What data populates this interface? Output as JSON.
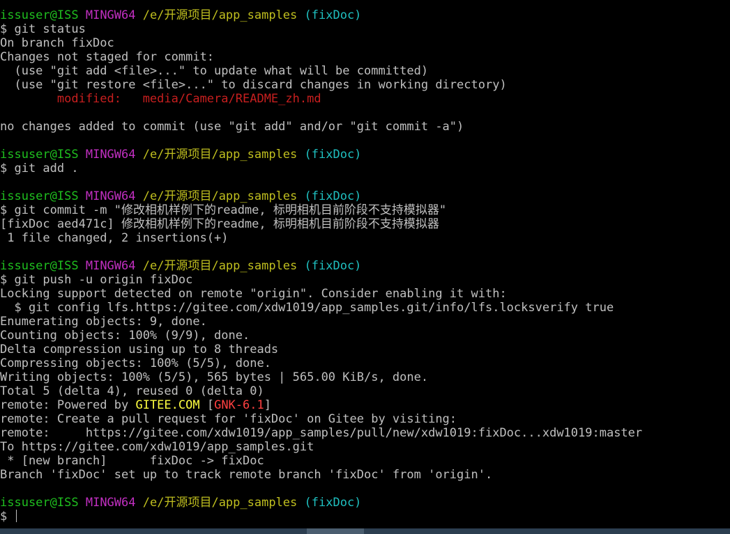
{
  "prompt": {
    "user_host": "issuser@ISS",
    "system": "MINGW64",
    "path": "/e/开源项目/app_samples",
    "branch": "(fixDoc)"
  },
  "lines": [
    {
      "type": "prompt"
    },
    {
      "type": "text",
      "segments": [
        {
          "text": "$ git status",
          "color": "default"
        }
      ]
    },
    {
      "type": "text",
      "segments": [
        {
          "text": "On branch fixDoc",
          "color": "default"
        }
      ]
    },
    {
      "type": "text",
      "segments": [
        {
          "text": "Changes not staged for commit:",
          "color": "default"
        }
      ]
    },
    {
      "type": "text",
      "segments": [
        {
          "text": "  (use \"git add <file>...\" to update what will be committed)",
          "color": "default"
        }
      ]
    },
    {
      "type": "text",
      "segments": [
        {
          "text": "  (use \"git restore <file>...\" to discard changes in working directory)",
          "color": "default"
        }
      ]
    },
    {
      "type": "text",
      "segments": [
        {
          "text": "        modified:   media/Camera/README_zh.md",
          "color": "red"
        }
      ]
    },
    {
      "type": "blank"
    },
    {
      "type": "text",
      "segments": [
        {
          "text": "no changes added to commit (use \"git add\" and/or \"git commit -a\")",
          "color": "default"
        }
      ]
    },
    {
      "type": "blank"
    },
    {
      "type": "prompt"
    },
    {
      "type": "text",
      "segments": [
        {
          "text": "$ git add .",
          "color": "default"
        }
      ]
    },
    {
      "type": "blank"
    },
    {
      "type": "prompt"
    },
    {
      "type": "text",
      "segments": [
        {
          "text": "$ git commit -m \"修改相机样例下的readme, 标明相机目前阶段不支持模拟器\"",
          "color": "default"
        }
      ]
    },
    {
      "type": "text",
      "segments": [
        {
          "text": "[fixDoc aed471c] 修改相机样例下的readme, 标明相机目前阶段不支持模拟器",
          "color": "default"
        }
      ]
    },
    {
      "type": "text",
      "segments": [
        {
          "text": " 1 file changed, 2 insertions(+)",
          "color": "default"
        }
      ]
    },
    {
      "type": "blank"
    },
    {
      "type": "prompt"
    },
    {
      "type": "text",
      "segments": [
        {
          "text": "$ git push -u origin fixDoc",
          "color": "default"
        }
      ]
    },
    {
      "type": "text",
      "segments": [
        {
          "text": "Locking support detected on remote \"origin\". Consider enabling it with:",
          "color": "default"
        }
      ]
    },
    {
      "type": "text",
      "segments": [
        {
          "text": "  $ git config lfs.https://gitee.com/xdw1019/app_samples.git/info/lfs.locksverify true",
          "color": "default"
        }
      ]
    },
    {
      "type": "text",
      "segments": [
        {
          "text": "Enumerating objects: 9, done.",
          "color": "default"
        }
      ]
    },
    {
      "type": "text",
      "segments": [
        {
          "text": "Counting objects: 100% (9/9), done.",
          "color": "default"
        }
      ]
    },
    {
      "type": "text",
      "segments": [
        {
          "text": "Delta compression using up to 8 threads",
          "color": "default"
        }
      ]
    },
    {
      "type": "text",
      "segments": [
        {
          "text": "Compressing objects: 100% (5/5), done.",
          "color": "default"
        }
      ]
    },
    {
      "type": "text",
      "segments": [
        {
          "text": "Writing objects: 100% (5/5), 565 bytes | 565.00 KiB/s, done.",
          "color": "default"
        }
      ]
    },
    {
      "type": "text",
      "segments": [
        {
          "text": "Total 5 (delta 4), reused 0 (delta 0)",
          "color": "default"
        }
      ]
    },
    {
      "type": "text",
      "segments": [
        {
          "text": "remote: Powered by ",
          "color": "default"
        },
        {
          "text": "GITEE.COM",
          "color": "byellow"
        },
        {
          "text": " [",
          "color": "default"
        },
        {
          "text": "GNK-6.1",
          "color": "bred"
        },
        {
          "text": "]",
          "color": "default"
        }
      ]
    },
    {
      "type": "text",
      "segments": [
        {
          "text": "remote: Create a pull request for 'fixDoc' on Gitee by visiting:",
          "color": "default"
        }
      ]
    },
    {
      "type": "text",
      "segments": [
        {
          "text": "remote:     https://gitee.com/xdw1019/app_samples/pull/new/xdw1019:fixDoc...xdw1019:master",
          "color": "default"
        }
      ]
    },
    {
      "type": "text",
      "segments": [
        {
          "text": "To https://gitee.com/xdw1019/app_samples.git",
          "color": "default"
        }
      ]
    },
    {
      "type": "text",
      "segments": [
        {
          "text": " * [new branch]      fixDoc -> fixDoc",
          "color": "default"
        }
      ]
    },
    {
      "type": "text",
      "segments": [
        {
          "text": "Branch 'fixDoc' set up to track remote branch 'fixDoc' from 'origin'.",
          "color": "default"
        }
      ]
    },
    {
      "type": "blank"
    },
    {
      "type": "prompt"
    },
    {
      "type": "input",
      "text": "$ "
    }
  ],
  "colors": {
    "default": "#c0c0c0",
    "green": "#1fbf1f",
    "magenta": "#c12fc1",
    "yellow": "#c0bf1f",
    "cyan": "#1fc0c0",
    "red": "#c81f1f",
    "byellow": "#ffff40",
    "bred": "#ff4040",
    "background": "#000000"
  }
}
